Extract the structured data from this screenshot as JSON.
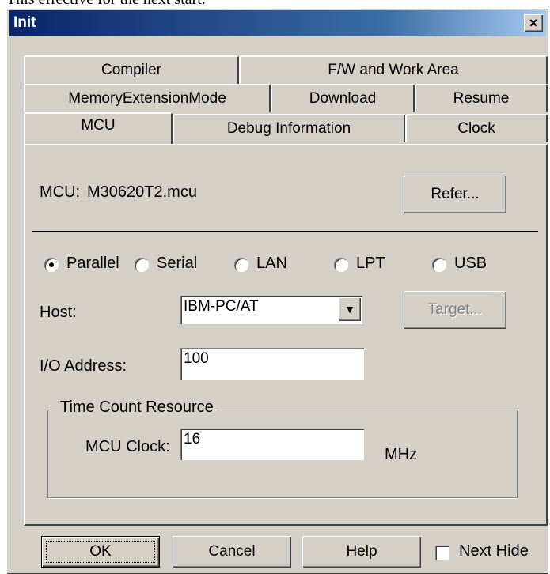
{
  "background_text": "This effective for the next start.",
  "window": {
    "title": "Init",
    "close_glyph": "×"
  },
  "tabs": {
    "row1": [
      "Compiler",
      "F/W and Work Area"
    ],
    "row2": [
      "MemoryExtensionMode",
      "Download",
      "Resume"
    ],
    "row3": [
      "MCU",
      "Debug Information",
      "Clock"
    ],
    "active": "MCU"
  },
  "mcu": {
    "label": "MCU:",
    "value": "M30620T2.mcu",
    "refer_button": "Refer..."
  },
  "connection": {
    "options": [
      "Parallel",
      "Serial",
      "LAN",
      "LPT",
      "USB"
    ],
    "selected": "Parallel"
  },
  "host": {
    "label": "Host:",
    "value": "IBM-PC/AT",
    "target_button": "Target..."
  },
  "io_address": {
    "label": "I/O Address:",
    "value": "100"
  },
  "time_count": {
    "group_label": "Time Count Resource",
    "clock_label": "MCU Clock:",
    "clock_value": "16",
    "unit": "MHz"
  },
  "footer": {
    "ok": "OK",
    "cancel": "Cancel",
    "help": "Help",
    "next_hide": "Next Hide",
    "next_hide_checked": false
  },
  "colors": {
    "titlebar_start": "#0a246a",
    "titlebar_end": "#a6caf0",
    "face": "#d4d0c8",
    "disabled_text": "#808080"
  }
}
